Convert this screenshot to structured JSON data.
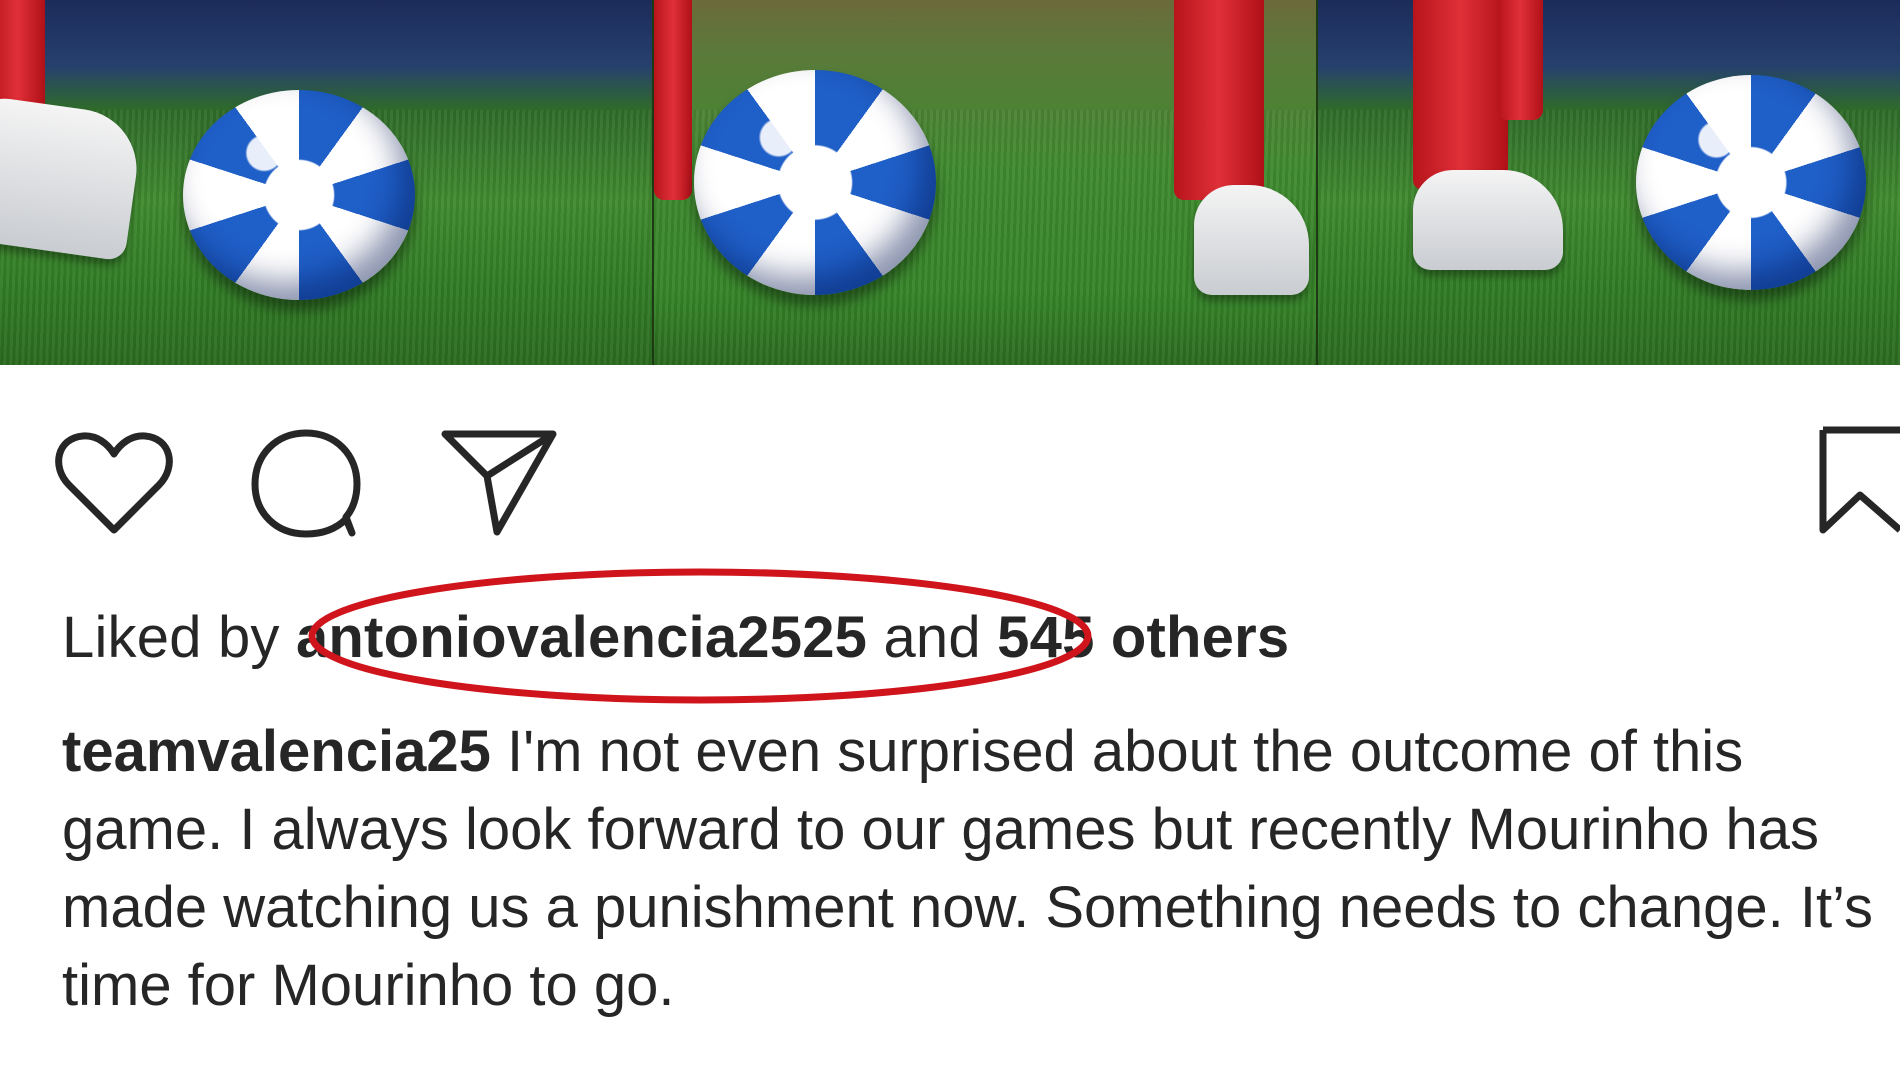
{
  "post": {
    "images": [
      {
        "alt": "football-photo-left"
      },
      {
        "alt": "football-photo-middle"
      },
      {
        "alt": "football-photo-right"
      }
    ],
    "actions": {
      "like_icon": "heart-icon",
      "comment_icon": "comment-icon",
      "share_icon": "paper-plane-icon",
      "save_icon": "bookmark-icon"
    },
    "likes": {
      "prefix": "Liked by",
      "user": "antoniovalencia2525",
      "connector": "and",
      "others": "545 others",
      "highlight_color": "#d0141b"
    },
    "caption": {
      "username": "teamvalencia25",
      "text": "I'm not even surprised about the outcome of this game. I always look forward to our games but recently Mourinho has made watching us a punishment now. Something needs to change. It’s time for Mourinho to go."
    }
  }
}
